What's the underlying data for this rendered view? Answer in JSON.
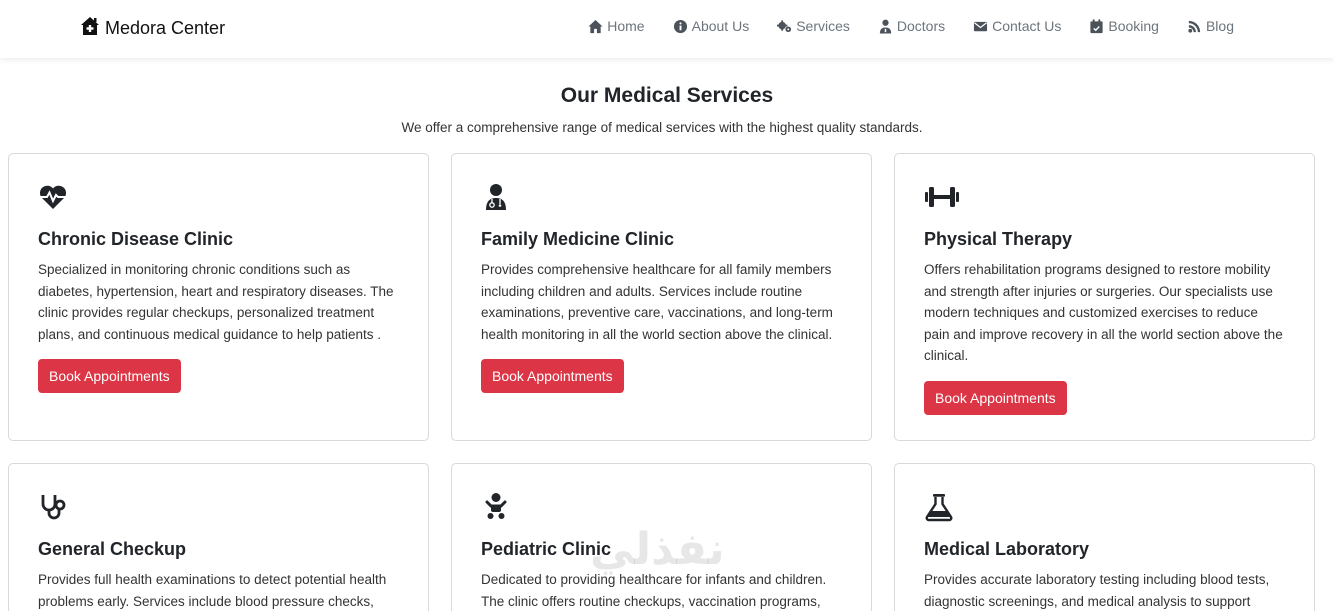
{
  "navbar": {
    "brand": "Medora Center",
    "items": [
      {
        "label": "Home",
        "icon": "home-icon"
      },
      {
        "label": "About Us",
        "icon": "info-circle-icon"
      },
      {
        "label": "Services",
        "icon": "gears-icon"
      },
      {
        "label": "Doctors",
        "icon": "user-md-icon"
      },
      {
        "label": "Contact Us",
        "icon": "envelope-icon"
      },
      {
        "label": "Booking",
        "icon": "calendar-check-icon"
      },
      {
        "label": "Blog",
        "icon": "blog-icon"
      }
    ]
  },
  "section": {
    "title": "Our Medical Services",
    "subtitle": "We offer a comprehensive range of medical services with the highest quality standards."
  },
  "cards": [
    {
      "icon": "heart-pulse-icon",
      "title": "Chronic Disease Clinic",
      "text": "Specialized in monitoring chronic conditions such as diabetes, hypertension, heart and respiratory diseases. The clinic provides regular checkups, personalized treatment plans, and continuous medical guidance to help patients .",
      "button": "Book Appointments"
    },
    {
      "icon": "doctor-icon",
      "title": "Family Medicine Clinic",
      "text": "Provides comprehensive healthcare for all family members including children and adults. Services include routine examinations, preventive care, vaccinations, and long-term health monitoring in all the world section above the clinical.",
      "button": "Book Appointments"
    },
    {
      "icon": "dumbbell-icon",
      "title": "Physical Therapy",
      "text": "Offers rehabilitation programs designed to restore mobility and strength after injuries or surgeries. Our specialists use modern techniques and customized exercises to reduce pain and improve recovery in all the world section above the clinical.",
      "button": "Book Appointments"
    },
    {
      "icon": "stethoscope-icon",
      "title": "General Checkup",
      "text": "Provides full health examinations to detect potential health problems early. Services include blood pressure checks,",
      "button": ""
    },
    {
      "icon": "baby-icon",
      "title": "Pediatric Clinic",
      "text": "Dedicated to providing healthcare for infants and children. The clinic offers routine checkups, vaccination programs,",
      "button": ""
    },
    {
      "icon": "flask-icon",
      "title": "Medical Laboratory",
      "text": "Provides accurate laboratory testing including blood tests, diagnostic screenings, and medical analysis to support",
      "button": ""
    }
  ],
  "watermark": "نفذلي"
}
